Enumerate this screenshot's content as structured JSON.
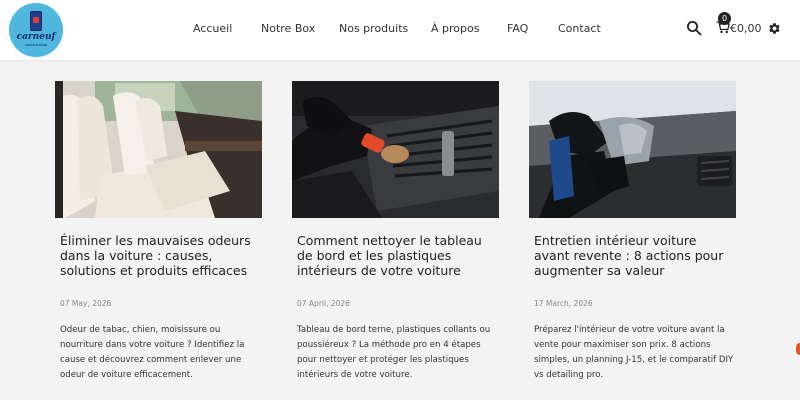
{
  "brand": {
    "logo_text": "carneuf",
    "logo_subtext": "carneuf.shop"
  },
  "nav": {
    "items": [
      {
        "label": "Accueil"
      },
      {
        "label": "Notre Box"
      },
      {
        "label": "Nos produits"
      },
      {
        "label": "À propos"
      },
      {
        "label": "FAQ"
      },
      {
        "label": "Contact"
      }
    ]
  },
  "header_icons": {
    "search": "search-icon",
    "cart": "cart-icon",
    "settings": "gear-icon",
    "cart_count": "0",
    "cart_total": "€0,00"
  },
  "posts": [
    {
      "image": "car-interior-seats-photo",
      "title": "Éliminer les mauvaises odeurs dans la voiture : causes, solutions et produits efficaces",
      "date": "07 May, 2026",
      "excerpt": "Odeur de tabac, chien, moisissure ou nourriture dans votre voiture ? Identifiez la cause et découvrez comment enlever une odeur de voiture efficacement."
    },
    {
      "image": "dashboard-vent-brush-photo",
      "title": "Comment nettoyer le tableau de bord et les plastiques intérieurs de votre voiture",
      "date": "07 April, 2026",
      "excerpt": "Tableau de bord terne, plastiques collants ou poussiéreux ? La méthode pro en 4 étapes pour nettoyer et protéger les plastiques intérieurs de votre voiture."
    },
    {
      "image": "dashboard-cloth-wipe-photo",
      "title": "Entretien intérieur voiture avant revente : 8 actions pour augmenter sa valeur",
      "date": "17 March, 2026",
      "excerpt": "Préparez l'intérieur de votre voiture avant la vente pour maximiser son prix. 8 actions simples, un planning J-15, et le comparatif DIY vs detailing pro."
    }
  ],
  "colors": {
    "header_bg": "#ffffff",
    "page_bg": "#f3f3f3",
    "logo_bg": "#4fb6dd",
    "accent": "#e2562a"
  }
}
